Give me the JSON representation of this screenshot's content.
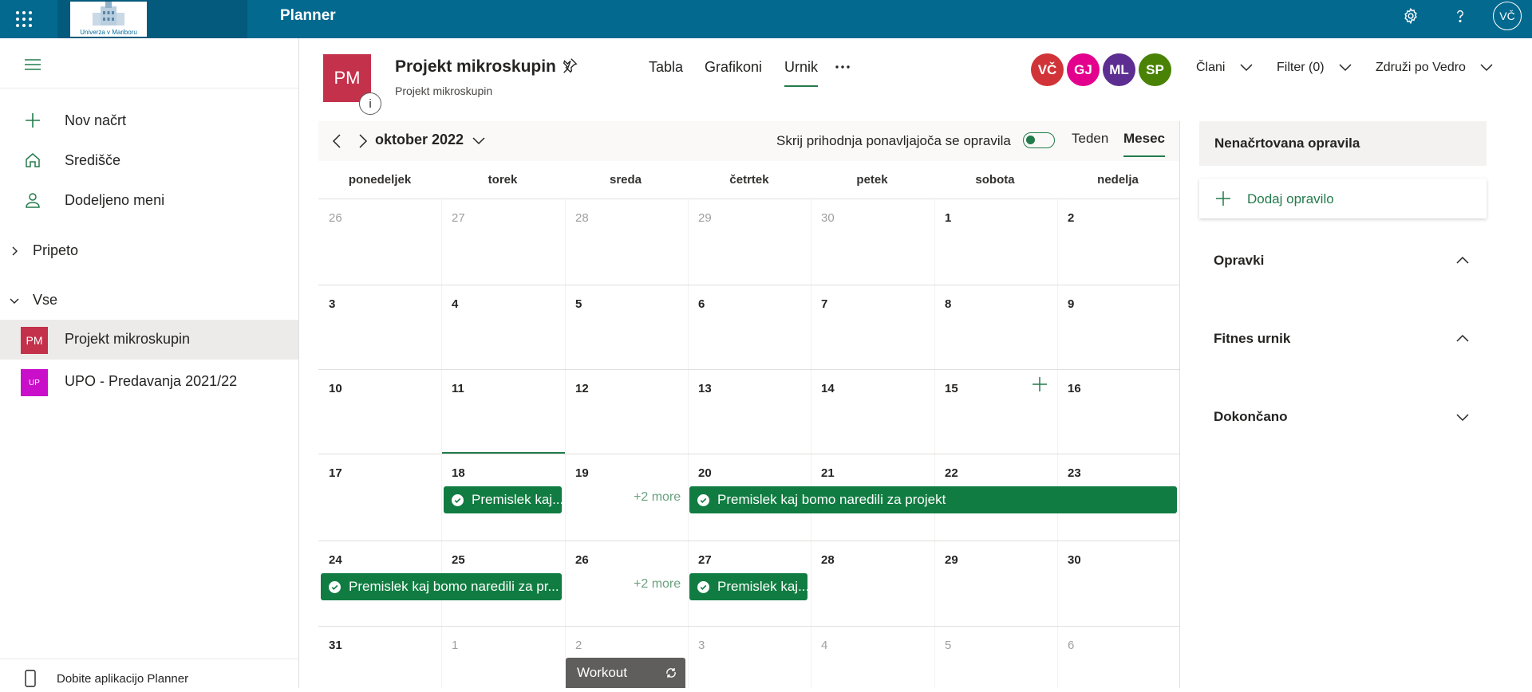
{
  "app": {
    "name": "Planner",
    "logo_text": "Univerza v Mariboru",
    "user_initials": "VČ"
  },
  "colors": {
    "topbar": "#03698f",
    "accent_green": "#237b4b",
    "task_green": "#107c41",
    "plan_pm": "#c4314b",
    "plan_up": "#c90fc9"
  },
  "nav": {
    "new_plan": "Nov načrt",
    "hub": "Središče",
    "assigned": "Dodeljeno meni",
    "pinned": "Pripeto",
    "all": "Vse",
    "plans": [
      {
        "tile": "PM",
        "label": "Projekt mikroskupin",
        "active": true
      },
      {
        "tile": "UP",
        "label": "UPO - Predavanja 2021/22",
        "active": false
      }
    ],
    "get_app": "Dobite aplikacijo Planner"
  },
  "plan": {
    "initials": "PM",
    "title": "Projekt mikroskupin",
    "group": "Projekt mikroskupin",
    "info_glyph": "i",
    "tabs": [
      "Tabla",
      "Grafikoni",
      "Urnik"
    ],
    "active_tab": "Urnik",
    "members": [
      {
        "initials": "VČ",
        "color": "#d13438"
      },
      {
        "initials": "GJ",
        "color": "#e3008c"
      },
      {
        "initials": "ML",
        "color": "#5c2e91"
      },
      {
        "initials": "SP",
        "color": "#498205"
      }
    ],
    "members_label": "Člani",
    "filter_label": "Filter (0)",
    "group_by_label": "Združi po Vedro"
  },
  "calendar": {
    "month_label": "oktober 2022",
    "hide_recurring_label": "Skrij prihodnja ponavljajoča se opravila",
    "view_week": "Teden",
    "view_month": "Mesec",
    "active_view": "Mesec",
    "weekdays": [
      "ponedeljek",
      "torek",
      "sreda",
      "četrtek",
      "petek",
      "sobota",
      "nedelja"
    ],
    "weeks": [
      [
        "26",
        "27",
        "28",
        "29",
        "30",
        "1",
        "2"
      ],
      [
        "3",
        "4",
        "5",
        "6",
        "7",
        "8",
        "9"
      ],
      [
        "10",
        "11",
        "12",
        "13",
        "14",
        "15",
        "16"
      ],
      [
        "17",
        "18",
        "19",
        "20",
        "21",
        "22",
        "23"
      ],
      [
        "24",
        "25",
        "26",
        "27",
        "28",
        "29",
        "30"
      ],
      [
        "31",
        "1",
        "2",
        "3",
        "4",
        "5",
        "6"
      ]
    ],
    "today": "18",
    "tasks": {
      "w4_tue": "Premislek kaj...",
      "w4_more": "+2 more",
      "w4_thu_sun": "Premislek kaj bomo naredili za projekt",
      "w5_mon_tue": "Premislek kaj bomo naredili za pr...",
      "w5_more": "+2 more",
      "w5_thu": "Premislek kaj..."
    },
    "recurring_task": "Workout"
  },
  "unscheduled": {
    "title": "Nenačrtovana opravila",
    "add_task": "Dodaj opravilo",
    "sections": [
      {
        "label": "Opravki",
        "expanded": true
      },
      {
        "label": "Fitnes urnik",
        "expanded": true
      },
      {
        "label": "Dokončano",
        "expanded": false
      }
    ]
  }
}
